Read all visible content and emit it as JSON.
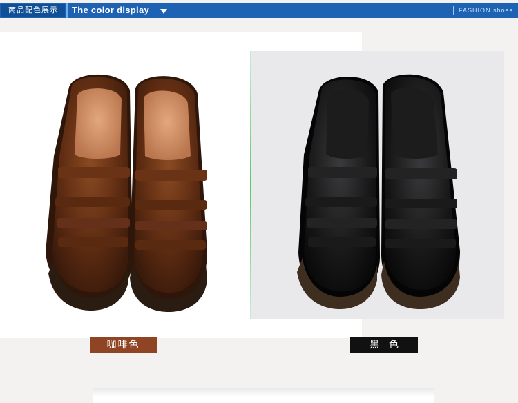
{
  "header": {
    "cn_title": "商品配色展示",
    "en_title": "The color display",
    "right_text": "FASHION shoes"
  },
  "products": [
    {
      "label": "咖啡色",
      "color": "#8f4424"
    },
    {
      "label": "黑色",
      "color": "#111111"
    }
  ],
  "colors": {
    "header_bg": "#1e62b4",
    "page_bg": "#f3f2f0"
  }
}
